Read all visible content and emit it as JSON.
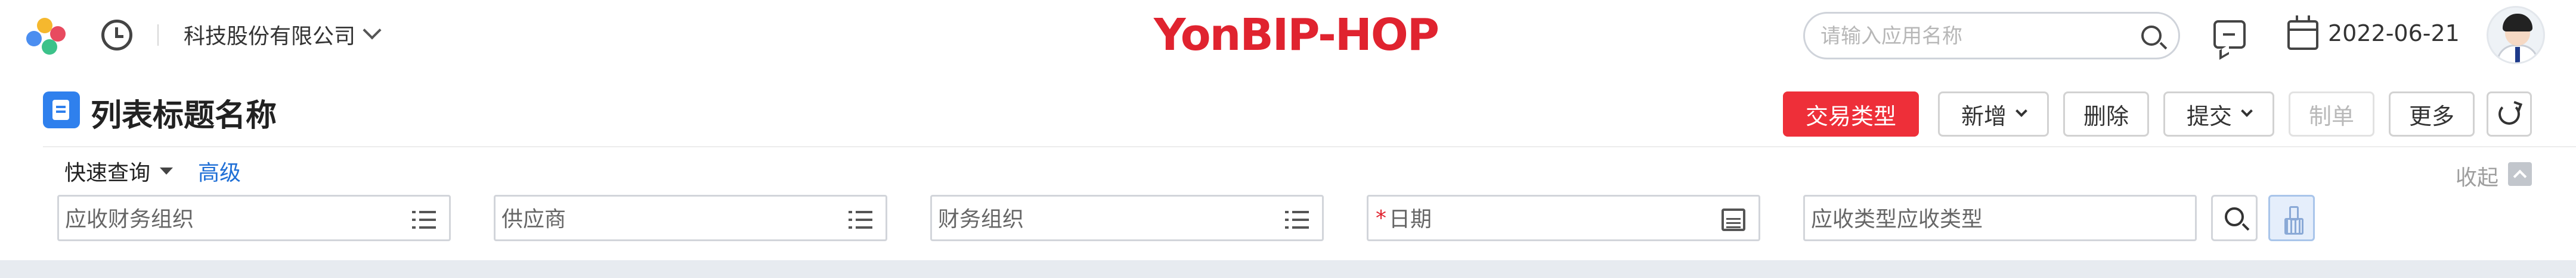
{
  "header": {
    "org_name": "科技股份有限公司",
    "brand": "YonBIP-HOP",
    "search_placeholder": "请输入应用名称",
    "date": "2022-06-21"
  },
  "page": {
    "title": "列表标题名称"
  },
  "toolbar": {
    "trade_type": "交易类型",
    "add": "新增",
    "delete": "删除",
    "submit": "提交",
    "make_order": "制单",
    "more": "更多"
  },
  "query": {
    "quick_query": "快速查询",
    "advanced": "高级",
    "collapse": "收起",
    "fields": {
      "receivable_org": "应收财务组织",
      "supplier": "供应商",
      "finance_org": "财务组织",
      "date": "日期",
      "receivable_type": "应收类型应收类型"
    },
    "required_mark": "*"
  },
  "colors": {
    "brand_red": "#e0232f",
    "primary_button": "#ee2f39",
    "title_icon_blue": "#2f80ed",
    "link_blue": "#1f6fd6",
    "logo_colors": [
      "#f26b3a",
      "#f5b82e",
      "#4b8ef0",
      "#3cc28a",
      "#e84a5f"
    ]
  }
}
